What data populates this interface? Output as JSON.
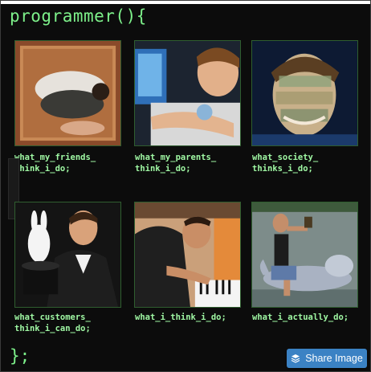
{
  "header": {
    "title": "programmer(){"
  },
  "footer": {
    "closing": "};"
  },
  "tiles": [
    {
      "caption": "what_my_friends_\nthink_i_do;"
    },
    {
      "caption": "what_my_parents_\nthink_i_do;"
    },
    {
      "caption": "what_society_\nthinks_i_do;"
    },
    {
      "caption": "what_customers_\nthink_i_can_do;"
    },
    {
      "caption": "what_i_think_i_do;"
    },
    {
      "caption": "what_i_actually_do;"
    }
  ],
  "share": {
    "label": "Share Image",
    "icon": "layers-icon"
  },
  "colors": {
    "code_green": "#7df08a",
    "caption_green": "#9ff7a3",
    "button_blue": "#3b82c4",
    "background": "#0c0c0c"
  }
}
